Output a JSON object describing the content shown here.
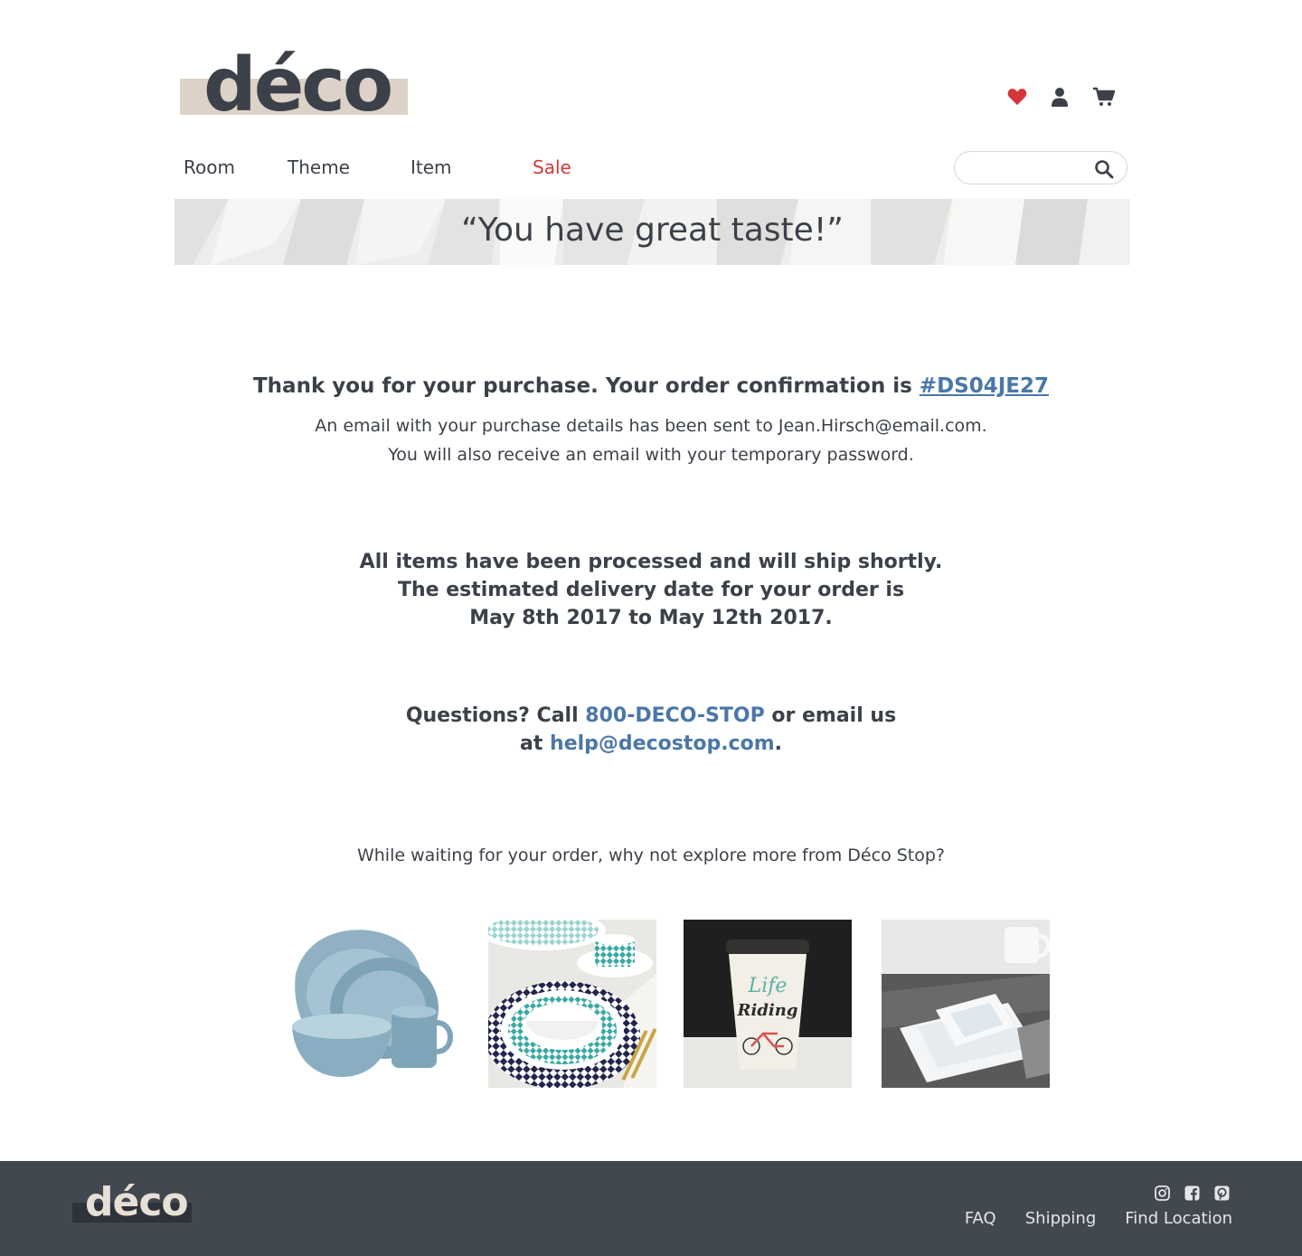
{
  "brand": {
    "logo_text": "déco",
    "accent_color": "#d63638",
    "link_color": "#4a77a8",
    "logo_band_color": "#dcd2c8"
  },
  "header": {
    "icons": [
      "heart-icon",
      "user-icon",
      "cart-icon"
    ]
  },
  "nav": {
    "items": [
      {
        "label": "Room"
      },
      {
        "label": "Theme"
      },
      {
        "label": "Item"
      },
      {
        "label": "Sale"
      }
    ]
  },
  "search": {
    "placeholder": "",
    "value": ""
  },
  "banner": {
    "quote": "“You have great taste!”"
  },
  "confirmation": {
    "thanks_prefix": "Thank you for your purchase. Your order confirmation is ",
    "order_number": "#DS04JE27",
    "email_line1": "An email with your purchase details has been sent to Jean.Hirsch@email.com.",
    "email_line2": "You will also receive an email with your temporary password."
  },
  "shipping": {
    "line1": "All items have been processed and will ship shortly.",
    "line2": "The estimated delivery date for your order is",
    "line3": "May 8th 2017 to May 12th 2017."
  },
  "questions": {
    "prefix": "Questions? Call ",
    "phone": "800-DECO-STOP",
    "middle": " or email us",
    "at": "at ",
    "email": "help@decostop.com",
    "suffix": "."
  },
  "explore": {
    "text": "While waiting for your order, why not explore more from Déco Stop?"
  },
  "products": [
    {
      "name": "blue-dinnerware-set"
    },
    {
      "name": "geometric-plate-set"
    },
    {
      "name": "life-like-riding-bicycle-cup"
    },
    {
      "name": "white-square-dishes"
    }
  ],
  "footer": {
    "logo_text": "déco",
    "social": [
      "instagram-icon",
      "facebook-icon",
      "pinterest-icon"
    ],
    "links": [
      {
        "label": "FAQ"
      },
      {
        "label": "Shipping"
      },
      {
        "label": "Find Location"
      }
    ]
  }
}
